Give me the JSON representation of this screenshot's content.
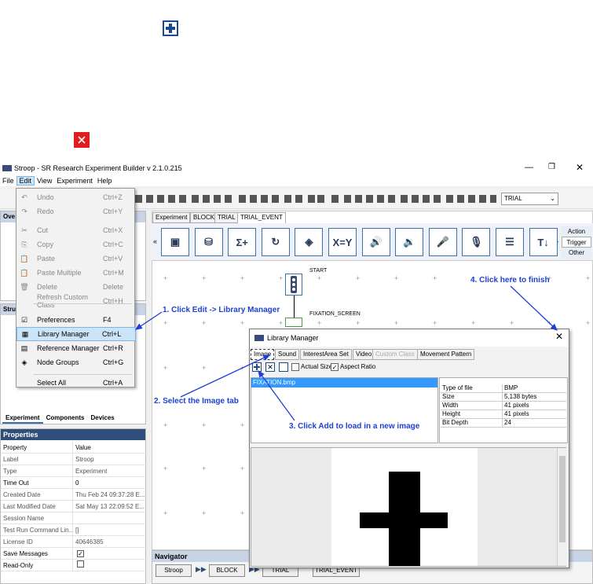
{
  "top_icons": {
    "plus_icon": "plus-box-icon",
    "close_icon": "red-x-icon"
  },
  "window": {
    "title": "Stroop - SR Research Experiment Builder v 2.1.0.215"
  },
  "menubar": [
    "File",
    "Edit",
    "View",
    "Experiment",
    "Help"
  ],
  "edit_menu": [
    {
      "label": "Undo",
      "shortcut": "Ctrl+Z",
      "disabled": true
    },
    {
      "label": "Redo",
      "shortcut": "Ctrl+Y",
      "disabled": true
    },
    {
      "label": "Cut",
      "shortcut": "Ctrl+X",
      "disabled": true
    },
    {
      "label": "Copy",
      "shortcut": "Ctrl+C",
      "disabled": true
    },
    {
      "label": "Paste",
      "shortcut": "Ctrl+V",
      "disabled": true
    },
    {
      "label": "Paste Multiple",
      "shortcut": "Ctrl+M",
      "disabled": true
    },
    {
      "label": "Delete",
      "shortcut": "Delete",
      "disabled": true
    },
    {
      "label": "Refresh Custom Class",
      "shortcut": "Ctrl+H",
      "disabled": true
    },
    {
      "label": "Preferences",
      "shortcut": "F4",
      "disabled": false
    },
    {
      "label": "Library Manager",
      "shortcut": "Ctrl+L",
      "disabled": false,
      "highlighted": true
    },
    {
      "label": "Reference Manager",
      "shortcut": "Ctrl+R",
      "disabled": false
    },
    {
      "label": "Node Groups",
      "shortcut": "Ctrl+G",
      "disabled": false
    },
    {
      "label": "Select All",
      "shortcut": "Ctrl+A",
      "disabled": false
    }
  ],
  "toolbar": {
    "combo_value": "TRIAL"
  },
  "left_panels": {
    "overview_title": "Ove",
    "structure_title": "Stru",
    "structure_tabs": [
      "Experiment",
      "Components",
      "Devices"
    ]
  },
  "properties": {
    "title": "Properties",
    "headers": [
      "Property",
      "Value"
    ],
    "rows": [
      {
        "key": "Label",
        "value": "Stroop"
      },
      {
        "key": "Type",
        "value": "Experiment"
      },
      {
        "key": "Time Out",
        "value": "0"
      },
      {
        "key": "Created Date",
        "value": "Thu Feb 24 09:37:28 E..."
      },
      {
        "key": "Last Modified Date",
        "value": "Sat May 13 22:09:52 E..."
      },
      {
        "key": "Session Name",
        "value": ""
      },
      {
        "key": "Test Run Command Lin...",
        "value": "[]"
      },
      {
        "key": "License ID",
        "value": "40646385"
      },
      {
        "key": "Save Messages",
        "value": "",
        "checked": true
      },
      {
        "key": "Read-Only",
        "value": "",
        "checked": false
      }
    ]
  },
  "editor_tabs": [
    "Experiment",
    "BLOCK",
    "TRIAL",
    "TRIAL_EVENT"
  ],
  "side_tabs": [
    "Action",
    "Trigger",
    "Other"
  ],
  "canvas": {
    "start_label": "START",
    "fixation_label": "FIXATION_SCREEN"
  },
  "library_manager": {
    "title": "Library Manager",
    "tabs": [
      "Image",
      "Sound",
      "InterestArea Set",
      "Video",
      "Custom Class",
      "Movement Pattern"
    ],
    "actual_size_label": "Actual Size",
    "aspect_ratio_label": "Aspect Ratio",
    "aspect_ratio_checked": true,
    "actual_size_checked": false,
    "files": [
      "FIXATION.bmp"
    ],
    "file_info": [
      {
        "key": "Type of file",
        "value": "BMP"
      },
      {
        "key": "Size",
        "value": "5,138 bytes"
      },
      {
        "key": "Width",
        "value": "41 pixels"
      },
      {
        "key": "Height",
        "value": "41 pixels"
      },
      {
        "key": "Bit Depth",
        "value": "24"
      }
    ]
  },
  "navigator": {
    "title": "Navigator",
    "items": [
      "Stroop",
      "BLOCK",
      "TRIAL",
      "TRIAL_EVENT"
    ]
  },
  "annotations": [
    "1. Click Edit -> Library Manager",
    "2. Select the Image tab",
    "3. Click Add to load in a new image",
    "4. Click here to finish"
  ],
  "colors": {
    "annotation": "#1d3fd6",
    "selection": "#3399ff",
    "menu_hover": "#cce4f7",
    "red_icon": "#e01e1e"
  }
}
